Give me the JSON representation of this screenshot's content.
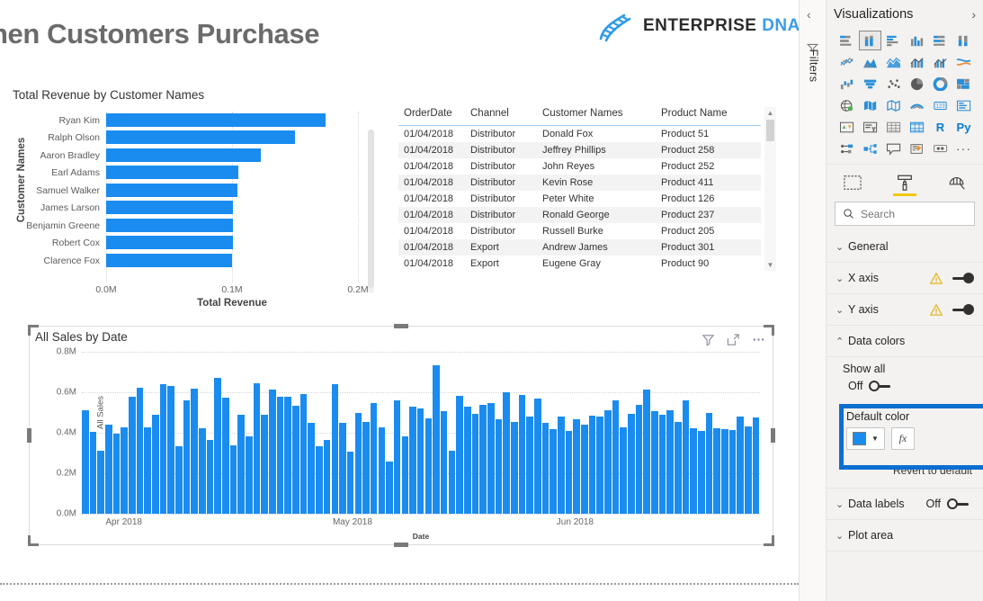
{
  "report": {
    "title": "hen Customers Purchase",
    "logo": {
      "icon": "dna-helix-icon",
      "word1": "ENTERPRISE",
      "word2": "DNA"
    }
  },
  "bar_visual": {
    "title": "Total Revenue by Customer Names",
    "scrollbar": "bar-chart-scrollbar"
  },
  "table_visual": {
    "columns": [
      "OrderDate",
      "Channel",
      "Customer Names",
      "Product Name"
    ],
    "rows": [
      [
        "01/04/2018",
        "Distributor",
        "Donald Fox",
        "Product 51"
      ],
      [
        "01/04/2018",
        "Distributor",
        "Jeffrey Phillips",
        "Product 258"
      ],
      [
        "01/04/2018",
        "Distributor",
        "John Reyes",
        "Product 252"
      ],
      [
        "01/04/2018",
        "Distributor",
        "Kevin Rose",
        "Product 411"
      ],
      [
        "01/04/2018",
        "Distributor",
        "Peter White",
        "Product 126"
      ],
      [
        "01/04/2018",
        "Distributor",
        "Ronald George",
        "Product 237"
      ],
      [
        "01/04/2018",
        "Distributor",
        "Russell Burke",
        "Product 205"
      ],
      [
        "01/04/2018",
        "Export",
        "Andrew James",
        "Product 301"
      ],
      [
        "01/04/2018",
        "Export",
        "Eugene Gray",
        "Product 90"
      ]
    ]
  },
  "sales_visual": {
    "title": "All Sales by Date",
    "icons": [
      "filter-icon",
      "focus-mode-icon",
      "more-options-icon"
    ]
  },
  "panel": {
    "filters_rail": {
      "collapse": "‹",
      "icon": "filter-funnel-icon",
      "label": "Filters"
    },
    "header": {
      "title": "Visualizations",
      "expand": "›"
    },
    "icon_grid": [
      "stacked-bar-chart-icon",
      "stacked-column-chart-icon",
      "clustered-bar-chart-icon",
      "clustered-column-chart-icon",
      "100-stacked-bar-chart-icon",
      "100-stacked-column-chart-icon",
      "line-chart-icon",
      "area-chart-icon",
      "stacked-area-chart-icon",
      "line-stacked-column-chart-icon",
      "line-clustered-column-chart-icon",
      "ribbon-chart-icon",
      "waterfall-chart-icon",
      "funnel-chart-icon",
      "scatter-chart-icon",
      "pie-chart-icon",
      "donut-chart-icon",
      "treemap-icon",
      "map-icon",
      "filled-map-icon",
      "shape-map-icon",
      "arcgis-map-icon",
      "card-icon",
      "multi-row-card-icon",
      "kpi-icon",
      "slicer-icon",
      "table-icon",
      "matrix-icon",
      "r-script-visual-icon",
      "python-visual-icon",
      "key-influencers-icon",
      "decomposition-tree-icon",
      "qna-icon",
      "smart-narrative-icon",
      "paginated-report-icon",
      "more-visuals-icon"
    ],
    "selected_icon_index": 1,
    "tabs": [
      {
        "name": "fields-tab",
        "icon": "fields-icon",
        "active": false
      },
      {
        "name": "format-tab",
        "icon": "paint-roller-icon",
        "active": true
      },
      {
        "name": "analytics-tab",
        "icon": "magnifier-analytics-icon",
        "active": false
      }
    ],
    "search": {
      "placeholder": "Search",
      "value": "",
      "icon": "search-icon"
    },
    "sections": [
      {
        "name": "General",
        "chevron": "⌄",
        "expanded": false,
        "warning": false,
        "toggle": null
      },
      {
        "name": "X axis",
        "chevron": "⌄",
        "expanded": false,
        "warning": true,
        "toggle": "on"
      },
      {
        "name": "Y axis",
        "chevron": "⌄",
        "expanded": false,
        "warning": true,
        "toggle": "on"
      },
      {
        "name": "Data colors",
        "chevron": "⌃",
        "expanded": true,
        "warning": false,
        "toggle": null
      }
    ],
    "data_colors": {
      "show_all_label": "Show all",
      "show_all_state": "Off",
      "default_color_label": "Default color",
      "default_color_hex": "#1a8cf0",
      "fx_label": "fx",
      "revert_label": "Revert to default",
      "highlight_color": "#0a6fd0"
    },
    "bottom_sections": [
      {
        "name": "Data labels",
        "chevron": "⌄",
        "state": "Off"
      },
      {
        "name": "Plot area",
        "chevron": "⌄",
        "state": null
      }
    ]
  },
  "chart_data": [
    {
      "type": "bar",
      "title": "Total Revenue by Customer Names",
      "xlabel": "Total Revenue",
      "ylabel": "Customer Names",
      "orientation": "horizontal",
      "categories": [
        "Ryan Kim",
        "Ralph Olson",
        "Aaron Bradley",
        "Earl Adams",
        "Samuel Walker",
        "James Larson",
        "Benjamin Greene",
        "Robert Cox",
        "Clarence Fox"
      ],
      "values": [
        174000,
        150000,
        123000,
        105000,
        104000,
        101000,
        101000,
        101000,
        100000
      ],
      "xticks": [
        "0.0M",
        "0.1M",
        "0.2M"
      ],
      "xlim": [
        0,
        200000
      ],
      "grid": true,
      "color": "#1a8cf0",
      "legend": "none"
    },
    {
      "type": "bar",
      "title": "All Sales by Date",
      "xlabel": "Date",
      "ylabel": "All Sales",
      "orientation": "vertical",
      "yticks": [
        "0.0M",
        "0.2M",
        "0.4M",
        "0.6M",
        "0.8M"
      ],
      "ylim": [
        0,
        800000
      ],
      "xticks": [
        "Apr 2018",
        "May 2018",
        "Jun 2018"
      ],
      "grid": true,
      "color": "#1a8cf0",
      "legend": "none",
      "values": [
        510000,
        405000,
        313000,
        440000,
        397000,
        425000,
        578000,
        623000,
        428000,
        490000,
        640000,
        633000,
        333000,
        560000,
        617000,
        424000,
        365000,
        673000,
        573000,
        340000,
        487000,
        383000,
        643000,
        487000,
        615000,
        577000,
        578000,
        535000,
        592000,
        450000,
        334000,
        363000,
        640000,
        450000,
        307000,
        500000,
        452000,
        545000,
        425000,
        259000,
        558000,
        382000,
        530000,
        520000,
        470000,
        733000,
        505000,
        312000,
        582000,
        527000,
        492000,
        540000,
        548000,
        467000,
        600000,
        455000,
        587000,
        482000,
        568000,
        450000,
        420000,
        478000,
        408000,
        465000,
        440000,
        485000,
        482000,
        510000,
        560000,
        425000,
        492000,
        538000,
        615000,
        505000,
        487000,
        512000,
        453000,
        560000,
        423000,
        410000,
        500000,
        422000,
        418000,
        414000,
        478000,
        432000,
        475000
      ]
    }
  ]
}
